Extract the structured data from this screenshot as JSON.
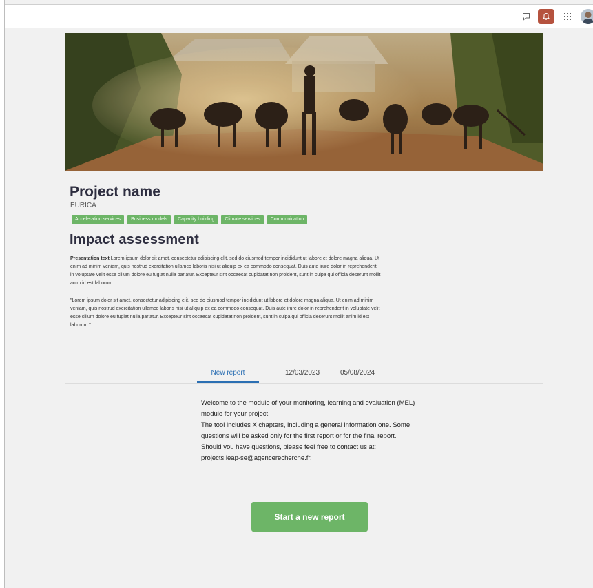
{
  "topbar": {
    "icons": [
      "chat-icon",
      "notification-bell-icon",
      "apps-grid-icon",
      "user-avatar"
    ],
    "bell_bg": "#b5523e"
  },
  "project": {
    "name": "Project name",
    "code": "EURICA",
    "tags": [
      "Acceleration services",
      "Business models",
      "Capacity building",
      "Climate services",
      "Communication"
    ]
  },
  "impact": {
    "title": "Impact assessment",
    "presentation_label": "Presentation text",
    "presentation_text": "Lorem ipsum dolor sit amet, consectetur adipiscing elit, sed do eiusmod tempor incididunt ut labore et dolore magna aliqua. Ut enim ad minim veniam, quis nostrud exercitation ullamco laboris nisi ut aliquip ex ea commodo consequat. Duis aute irure dolor in reprehenderit in voluptate velit esse cillum dolore eu fugiat nulla pariatur. Excepteur sint occaecat cupidatat non proident, sunt in culpa qui officia deserunt mollit anim id est laborum.",
    "quote": "\"Lorem ipsum dolor sit amet, consectetur adipiscing elit, sed do eiusmod tempor incididunt ut labore et dolore magna aliqua. Ut enim ad minim veniam, quis nostrud exercitation ullamco laboris nisi ut aliquip ex ea commodo consequat. Duis aute irure dolor in reprehenderit in voluptate velit esse cillum dolore eu fugiat nulla pariatur. Excepteur sint occaecat cupidatat non proident, sunt in culpa qui officia deserunt mollit anim id est laborum.\""
  },
  "tabs": [
    "New report",
    "12/03/2023",
    "05/08/2024"
  ],
  "welcome": {
    "lines": [
      "Welcome to the module of your monitoring, learning and evaluation (MEL)",
      "module for your project.",
      "The tool includes X chapters, including a general information one. Some",
      "questions will be asked only for the first report or for the final report.",
      "Should you have questions, please feel free to contact us at:",
      " projects.leap-se@agencerecherche.fr."
    ]
  },
  "cta": {
    "label": "Start a new report"
  },
  "colors": {
    "accent_green": "#6db567",
    "tab_blue": "#2b6fb3",
    "title": "#2e2e40"
  }
}
